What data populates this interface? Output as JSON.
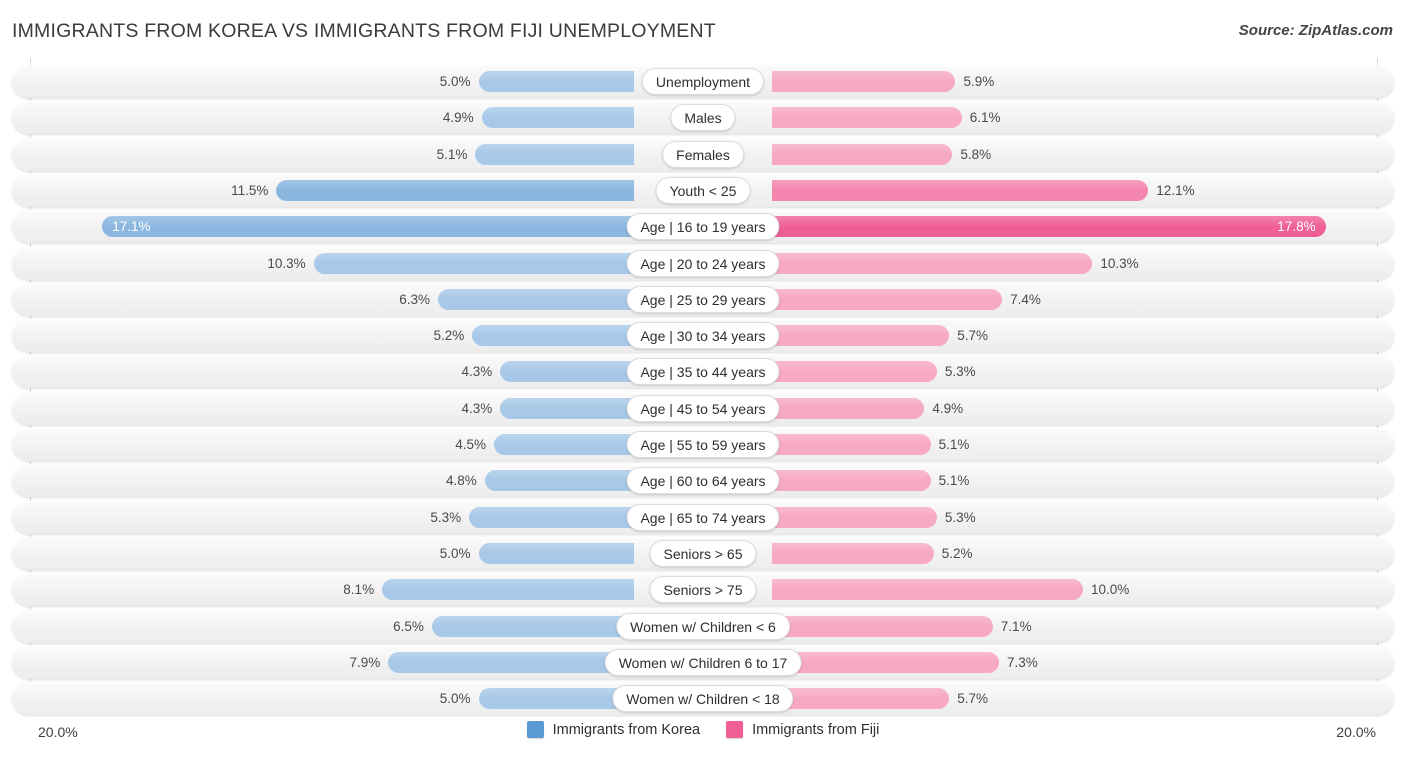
{
  "header": {
    "title": "IMMIGRANTS FROM KOREA VS IMMIGRANTS FROM FIJI UNEMPLOYMENT",
    "source": "Source: ZipAtlas.com"
  },
  "axis": {
    "left_cap": "20.0%",
    "right_cap": "20.0%",
    "max": 20.0
  },
  "legend": {
    "items": [
      {
        "label": "Immigrants from Korea",
        "color": "#5b9bd5"
      },
      {
        "label": "Immigrants from Fiji",
        "color": "#ef5f96"
      }
    ]
  },
  "colors": {
    "left_light": "#a7c8e8",
    "left_mid": "#8ab6e0",
    "left_dark": "#5b9bd5",
    "right_light": "#f7a8c4",
    "right_mid": "#f485ae",
    "right_dark": "#ef5f96",
    "row_bg": "#f2f2f2",
    "text": "#4a4a4a"
  },
  "chart_data": {
    "type": "bar",
    "orientation": "horizontal-diverging",
    "title": "IMMIGRANTS FROM KOREA VS IMMIGRANTS FROM FIJI UNEMPLOYMENT",
    "xlabel": "",
    "ylabel": "",
    "xlim": [
      20.0,
      20.0
    ],
    "grid": false,
    "legend_position": "bottom-center",
    "categories": [
      "Unemployment",
      "Males",
      "Females",
      "Youth < 25",
      "Age | 16 to 19 years",
      "Age | 20 to 24 years",
      "Age | 25 to 29 years",
      "Age | 30 to 34 years",
      "Age | 35 to 44 years",
      "Age | 45 to 54 years",
      "Age | 55 to 59 years",
      "Age | 60 to 64 years",
      "Age | 65 to 74 years",
      "Seniors > 65",
      "Seniors > 75",
      "Women w/ Children < 6",
      "Women w/ Children 6 to 17",
      "Women w/ Children < 18"
    ],
    "series": [
      {
        "name": "Immigrants from Korea",
        "side": "left",
        "values": [
          5.0,
          4.9,
          5.1,
          11.5,
          17.1,
          10.3,
          6.3,
          5.2,
          4.3,
          4.3,
          4.5,
          4.8,
          5.3,
          5.0,
          8.1,
          6.5,
          7.9,
          5.0
        ],
        "labels": [
          "5.0%",
          "4.9%",
          "5.1%",
          "11.5%",
          "17.1%",
          "10.3%",
          "6.3%",
          "5.2%",
          "4.3%",
          "4.3%",
          "4.5%",
          "4.8%",
          "5.3%",
          "5.0%",
          "8.1%",
          "6.5%",
          "7.9%",
          "5.0%"
        ]
      },
      {
        "name": "Immigrants from Fiji",
        "side": "right",
        "values": [
          5.9,
          6.1,
          5.8,
          12.1,
          17.8,
          10.3,
          7.4,
          5.7,
          5.3,
          4.9,
          5.1,
          5.1,
          5.3,
          5.2,
          10.0,
          7.1,
          7.3,
          5.7
        ],
        "labels": [
          "5.9%",
          "6.1%",
          "5.8%",
          "12.1%",
          "17.8%",
          "10.3%",
          "7.4%",
          "5.7%",
          "5.3%",
          "4.9%",
          "5.1%",
          "5.1%",
          "5.3%",
          "5.2%",
          "10.0%",
          "7.1%",
          "7.3%",
          "5.7%"
        ]
      }
    ]
  }
}
